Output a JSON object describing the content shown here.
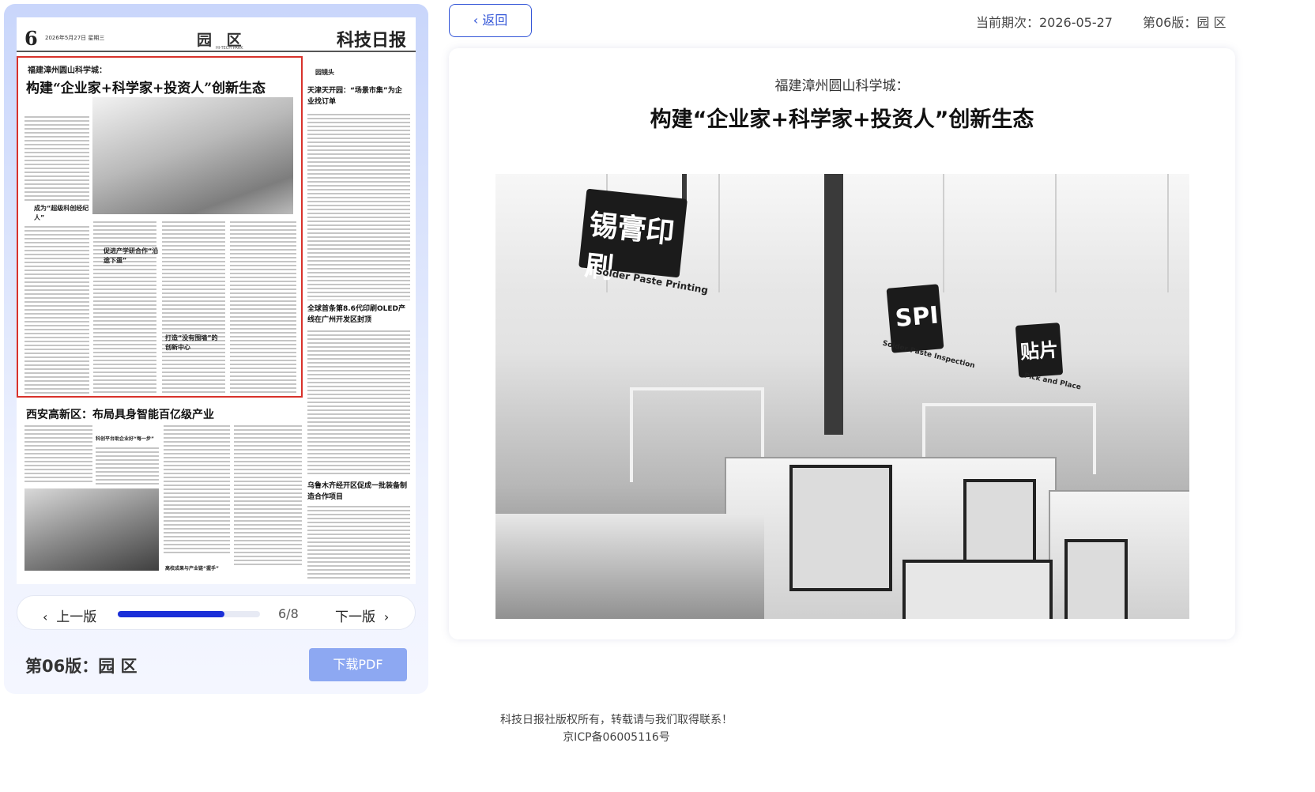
{
  "nav": {
    "back_label": "返回",
    "current_issue_label": "当前期次：2026-05-27",
    "edition_label": "第06版：园 区"
  },
  "newspaper": {
    "page_number": "6",
    "date_line": "2026年5月27日 星期三",
    "section": "园 区",
    "section_en": "HI-TECH PARK",
    "masthead": "科技日报",
    "lead_kicker": "福建漳州圆山科学城：",
    "lead_title": "构建“企业家+科学家+投资人”创新生态",
    "lead_sub1": "成为“超级科创经纪人”",
    "lead_sub2": "促进产学研合作“沿途下蛋”",
    "lead_sub3": "打造“没有围墙”的创新中心",
    "right_col_tag": "园镜头",
    "right_story1_title": "天津天开园：“场景市集”为企业找订单",
    "right_story2_title": "全球首条第8.6代印刷OLED产线在广州开发区封顶",
    "right_story3_title": "乌鲁木齐经开区促成一批装备制造合作项目",
    "lower_title": "西安高新区：布局具身智能百亿级产业",
    "lower_sub1": "科创平台助企业好“每一步”",
    "lower_sub2": "高校成果与产业链“握手”"
  },
  "pager": {
    "prev_label": "上一版",
    "next_label": "下一版",
    "count_label": "6/8",
    "progress": 0.75
  },
  "edition_title": "第06版：园 区",
  "download_label": "下载PDF",
  "article": {
    "kicker": "福建漳州圆山科学城：",
    "title": "构建“企业家+科学家+投资人”创新生态",
    "photo": {
      "sign1_cn": "锡膏印刷",
      "sign1_en": "Solder Paste Printing",
      "sign2_cn": "SPI",
      "sign2_en": "Solder Paste Inspection",
      "sign3_cn": "贴片",
      "sign3_en": "Pick and Place"
    }
  },
  "footer": {
    "copyright": "科技日报社版权所有，转载请与我们取得联系！",
    "icp": "京ICP备06005116号"
  },
  "colors": {
    "accent": "#3557d8",
    "progress": "#1a2fd8",
    "download_button": "#8da8f2",
    "highlight_border": "#d8322b"
  }
}
